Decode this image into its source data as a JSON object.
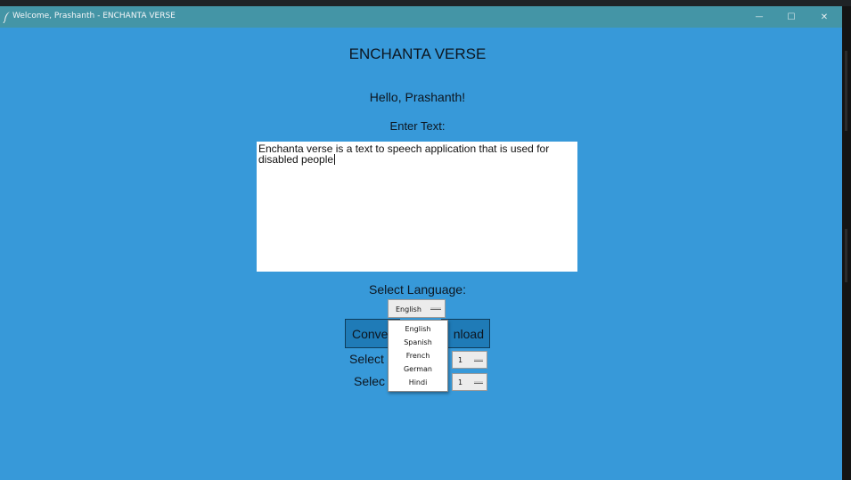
{
  "window": {
    "title": "Welcome, Prashanth - ENCHANTA VERSE",
    "minimize_glyph": "—",
    "maximize_glyph": "☐",
    "close_glyph": "✕"
  },
  "app": {
    "heading": "ENCHANTA VERSE",
    "greeting": "Hello, Prashanth!",
    "enter_text_label": "Enter Text:",
    "text_value": "Enchanta verse is a text to speech application that is used for\ndisabled people",
    "select_language_label": "Select Language:",
    "selected_language": "English",
    "convert_label": "Conve",
    "download_label": "nload",
    "select_label_1": "Select",
    "select_label_2": "Selec",
    "select_value_1": "1",
    "select_value_2": "1"
  },
  "dropdown": {
    "options": [
      "English",
      "Spanish",
      "French",
      "German",
      "Hindi"
    ]
  },
  "colors": {
    "background": "#3799d9",
    "titlebar": "#4495a6",
    "button": "#1f7bb7"
  }
}
